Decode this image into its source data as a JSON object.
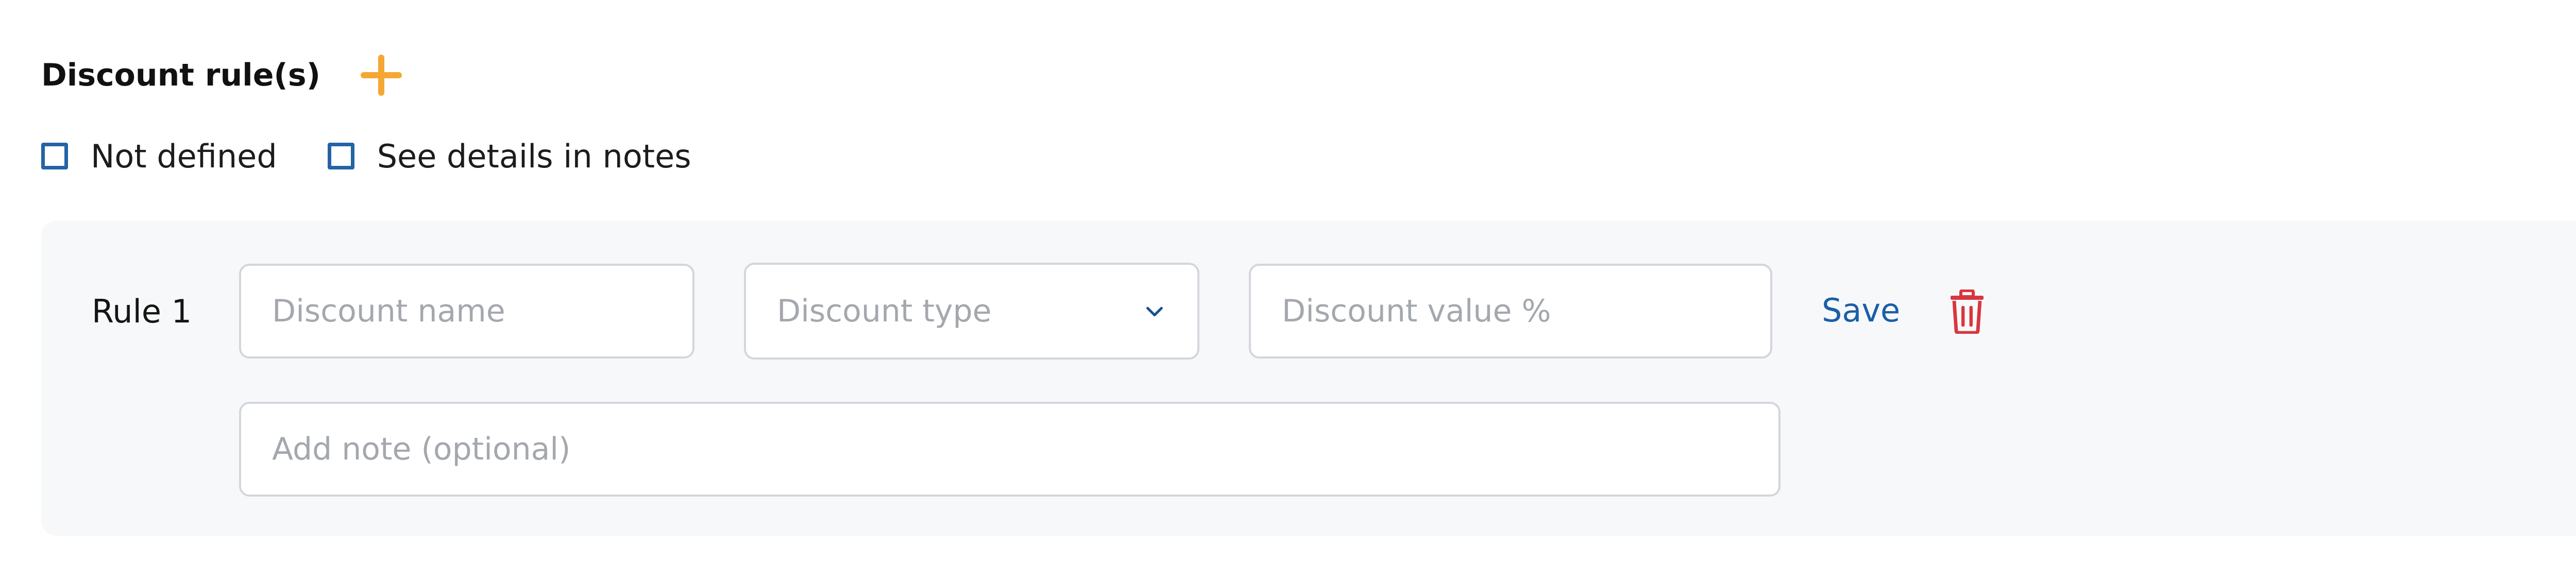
{
  "section": {
    "title": "Discount rule(s)",
    "add_icon": "plus-icon",
    "accent_color": "#f5a733"
  },
  "options": [
    {
      "label": "Not defined",
      "checked": false
    },
    {
      "label": "See details in notes",
      "checked": false
    }
  ],
  "rule": {
    "label": "Rule 1",
    "name_placeholder": "Discount name",
    "type_placeholder": "Discount type",
    "type_icon": "chevron-down-icon",
    "value_placeholder": "Discount value %",
    "save_label": "Save",
    "delete_icon": "trash-icon",
    "note_placeholder": "Add note (optional)",
    "link_color": "#1a5ea8",
    "delete_color": "#d9363e"
  }
}
